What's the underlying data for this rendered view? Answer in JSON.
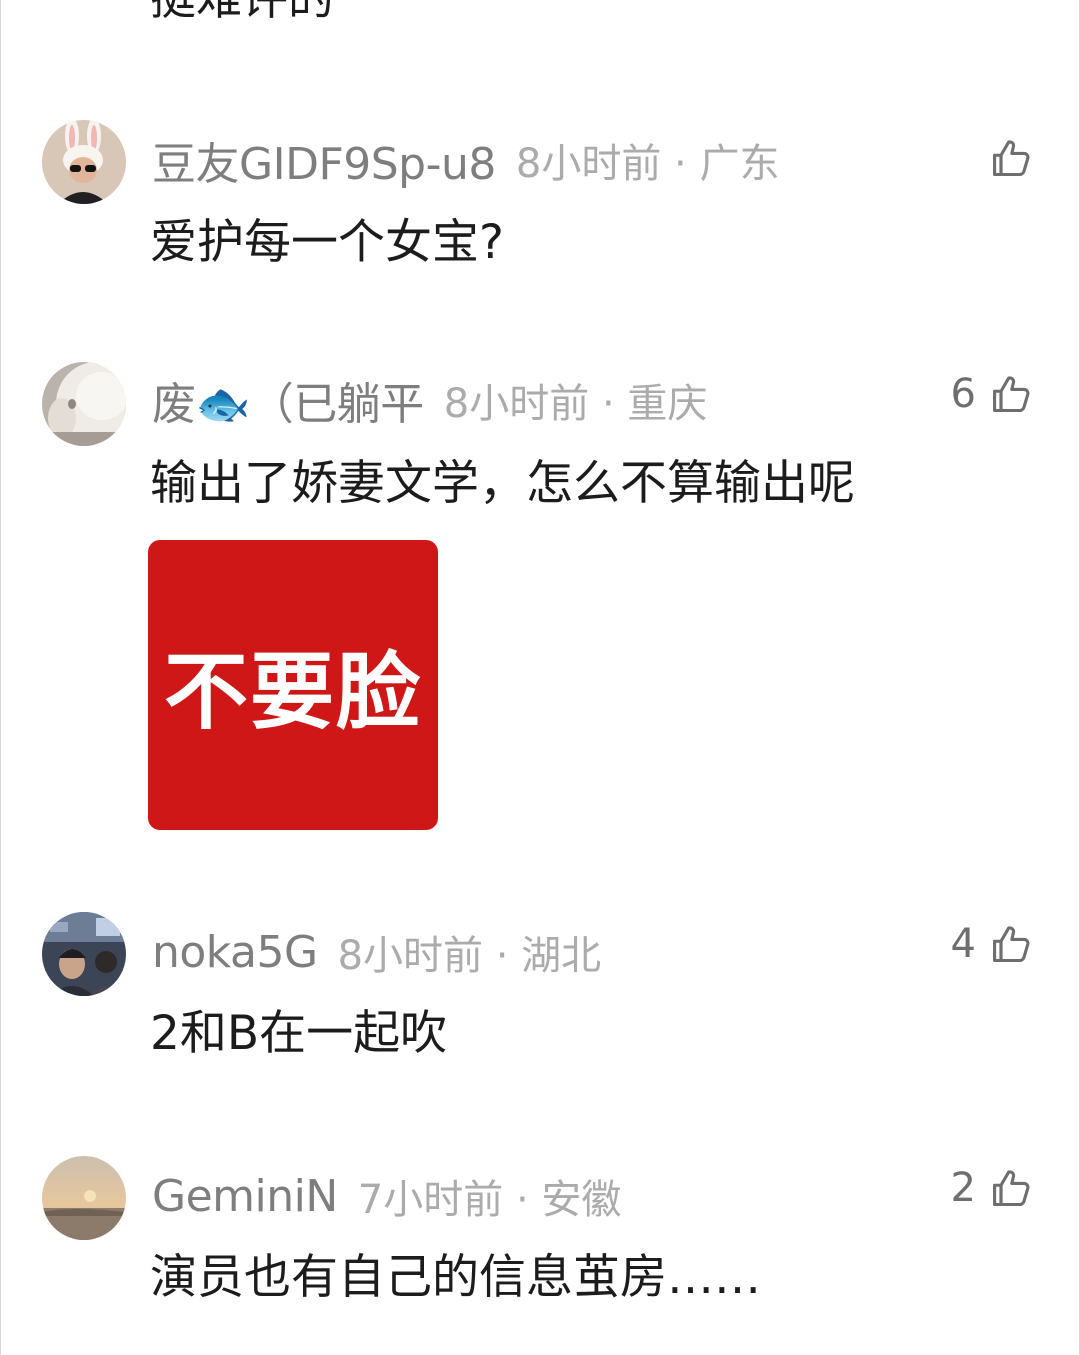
{
  "prev_comment_tail": "挺难评的",
  "comments": [
    {
      "username": "豆友GIDF9Sp-u8",
      "time_location": "8小时前 · 广东",
      "likes": "",
      "text": "爱护每一个女宝?",
      "avatar_icon": "avatar-bunny-ears-sunglasses"
    },
    {
      "username": "废🐟（已躺平",
      "time_location": "8小时前 · 重庆",
      "likes": "6",
      "text": "输出了娇妻文学，怎么不算输出呢",
      "sticker_text": "不要脸",
      "sticker_color": "#cf1717",
      "avatar_icon": "avatar-white-plush"
    },
    {
      "username": "noka5G",
      "time_location": "8小时前 · 湖北",
      "likes": "4",
      "text": "2和B在一起吹",
      "avatar_icon": "avatar-crowd-photo"
    },
    {
      "username": "GeminiN",
      "time_location": "7小时前 · 安徽",
      "likes": "2",
      "text": "演员也有自己的信息茧房……",
      "avatar_icon": "avatar-sunset-photo"
    }
  ],
  "colors": {
    "username": "#7e7e7e",
    "meta": "#ababab",
    "text": "#1c1c1c"
  },
  "icons": {
    "like": "thumbs-up-icon"
  }
}
